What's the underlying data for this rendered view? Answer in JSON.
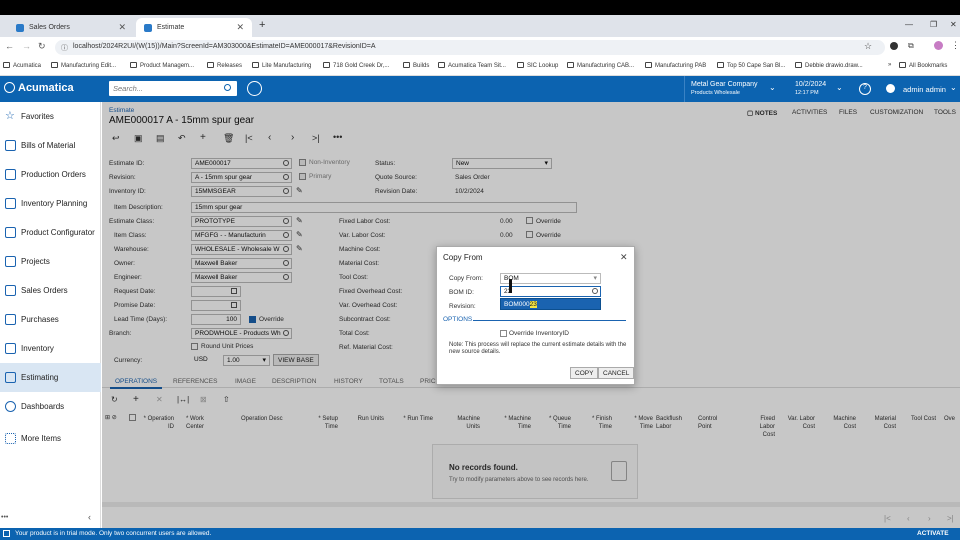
{
  "browser": {
    "tabs": [
      {
        "label": "Sales Orders"
      },
      {
        "label": "Estimate"
      }
    ],
    "new_tab": "+",
    "url": "localhost/2024R2UI/(W(15))/Main?ScreenId=AM303000&EstimateID=AME000017&RevisionID=A",
    "bookmarks": [
      "Acumatica",
      "Manufacturing Edit...",
      "Product Managem...",
      "Releases",
      "Lite Manufacturing",
      "718 Gold Creek Dr,...",
      "Builds",
      "Acumatica Team Sit...",
      "SIC Lookup",
      "Manufacturing CAB...",
      "Manufacturing PAB",
      "Top 50 Cape San Bl...",
      "Debbie drawio.draw...",
      "All Bookmarks"
    ]
  },
  "appbar": {
    "logo": "Acumatica",
    "search_placeholder": "Search...",
    "company": "Metal Gear Company",
    "branch": "Products Wholesale",
    "date": "10/2/2024",
    "time": "12:17 PM",
    "user": "admin admin"
  },
  "sidebar": {
    "items": [
      {
        "label": "Favorites"
      },
      {
        "label": "Bills of Material"
      },
      {
        "label": "Production Orders"
      },
      {
        "label": "Inventory Planning"
      },
      {
        "label": "Product Configurator"
      },
      {
        "label": "Projects"
      },
      {
        "label": "Sales Orders"
      },
      {
        "label": "Purchases"
      },
      {
        "label": "Inventory"
      },
      {
        "label": "Estimating"
      },
      {
        "label": "Dashboards"
      },
      {
        "label": "More Items"
      }
    ]
  },
  "page": {
    "breadcrumb": "Estimate",
    "title": "AME000017 A - 15mm spur gear",
    "actions": [
      "NOTES",
      "ACTIVITIES",
      "FILES",
      "CUSTOMIZATION",
      "TOOLS"
    ]
  },
  "form": {
    "estimate_id_label": "Estimate ID:",
    "estimate_id": "AME000017",
    "revision_label": "Revision:",
    "revision": "A - 15mm spur gear",
    "inventory_id_label": "Inventory ID:",
    "inventory_id": "15MMSGEAR",
    "item_desc_label": "Item Description:",
    "item_desc": "15mm spur gear",
    "estimate_class_label": "Estimate Class:",
    "estimate_class": "PROTOTYPE",
    "item_class_label": "Item Class:",
    "item_class": "MFGFG  - - Manufacturin",
    "warehouse_label": "Warehouse:",
    "warehouse": "WHOLESALE - Wholesale W",
    "owner_label": "Owner:",
    "owner": "Maxwell Baker",
    "engineer_label": "Engineer:",
    "engineer": "Maxwell Baker",
    "request_date_label": "Request Date:",
    "promise_date_label": "Promise Date:",
    "lead_time_label": "Lead Time (Days):",
    "lead_time": "100",
    "override_label": "Override",
    "branch_label": "Branch:",
    "branch": "PRODWHOLE - Products Wh",
    "round_unit_label": "Round Unit Prices",
    "currency_label": "Currency:",
    "currency": "USD",
    "rate": "1.00",
    "view_base": "VIEW BASE",
    "non_inventory_label": "Non-Inventory",
    "primary_label": "Primary",
    "status_label": "Status:",
    "status": "New",
    "quote_source_label": "Quote Source:",
    "quote_source": "Sales Order",
    "revision_date_label": "Revision Date:",
    "revision_date": "10/2/2024",
    "costs": [
      {
        "label": "Fixed Labor Cost:",
        "value": "0.00"
      },
      {
        "label": "Var. Labor Cost:",
        "value": "0.00"
      },
      {
        "label": "Machine Cost:",
        "value": ""
      },
      {
        "label": "Material Cost:",
        "value": ""
      },
      {
        "label": "Tool Cost:",
        "value": ""
      },
      {
        "label": "Fixed Overhead Cost:",
        "value": ""
      },
      {
        "label": "Var. Overhead Cost:",
        "value": ""
      },
      {
        "label": "Subcontract Cost:",
        "value": ""
      },
      {
        "label": "Total Cost:",
        "value": ""
      },
      {
        "label": "Ref. Material Cost:",
        "value": ""
      }
    ]
  },
  "tabs": [
    "OPERATIONS",
    "REFERENCES",
    "IMAGE",
    "DESCRIPTION",
    "HISTORY",
    "TOTALS",
    "PRIC"
  ],
  "grid": {
    "columns": [
      "* Operation ID",
      "* Work Center",
      "Operation Desc",
      "* Setup Time",
      "Run Units",
      "* Run Time",
      "Machine Units",
      "* Machine Time",
      "* Queue Time",
      "* Finish Time",
      "* Move Time",
      "Backflush Labor",
      "Control Point",
      "Fixed Labor Cost",
      "Var. Labor Cost",
      "Machine Cost",
      "Material Cost",
      "Tool Cost",
      "Ove"
    ],
    "empty_title": "No records found.",
    "empty_hint": "Try to modify parameters above to see records here."
  },
  "dialog": {
    "title": "Copy From",
    "copy_from_label": "Copy From:",
    "copy_from": "BOM",
    "bom_id_label": "BOM ID:",
    "bom_id": "23",
    "revision_label": "Revision:",
    "dropdown_option_prefix": "BOM000",
    "dropdown_option_match": "23",
    "options_header": "OPTIONS",
    "override_label": "Override InventoryID",
    "note": "Note: This process will replace the current estimate details with the new source details.",
    "copy_button": "COPY",
    "cancel_button": "CANCEL"
  },
  "statusbar": {
    "message": "Your product is in trial mode. Only two concurrent users are allowed.",
    "activate": "ACTIVATE"
  }
}
